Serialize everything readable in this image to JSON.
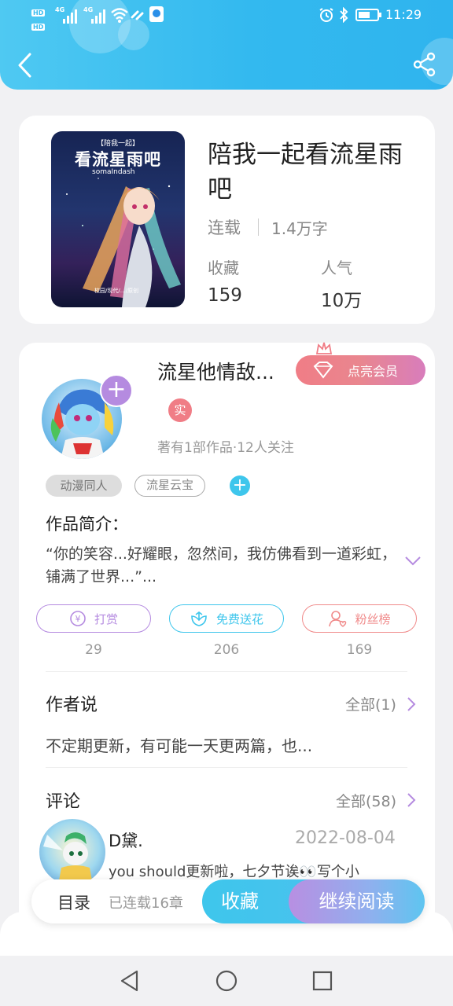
{
  "status_bar": {
    "net1": "4G",
    "net2": "4G",
    "hd1": "HD",
    "hd2": "HD",
    "time": "11:29"
  },
  "book": {
    "title": "陪我一起看流星雨吧",
    "status": "连载",
    "word_count": "1.4万字",
    "collect_label": "收藏",
    "collect_value": "159",
    "popularity_label": "人气",
    "popularity_value": "10万",
    "cover": {
      "top_text": "【陪我一起】",
      "main_text": "看流星雨吧",
      "author_text": "somaIndash",
      "bottom_text": "校园/现代/…/原创"
    }
  },
  "author": {
    "name": "流星他情敌...",
    "verified_badge": "实",
    "stats": "著有1部作品·12人关注",
    "member_button": "点亮会员"
  },
  "tags": [
    "动漫同人",
    "流星云宝"
  ],
  "intro": {
    "heading": "作品简介：",
    "text": "“你的笑容...好耀眼，忽然间，我仿佛看到一道彩虹，铺满了世界...”..."
  },
  "actions": [
    {
      "label": "打赏",
      "count": "29",
      "color": "#b58be0"
    },
    {
      "label": "免费送花",
      "count": "206",
      "color": "#3ec6ec"
    },
    {
      "label": "粉丝榜",
      "count": "169",
      "color": "#f08a8a"
    }
  ],
  "author_says": {
    "heading": "作者说",
    "all_link": "全部(1)",
    "text": "不定期更新，有可能一天更两篇，也..."
  },
  "comments": {
    "heading": "评论",
    "all_link": "全部(58)",
    "first": {
      "user": "D黛.",
      "date": "2022-08-04",
      "text": "you should更新啦，七夕节诶👀写个小"
    }
  },
  "bottom_bar": {
    "toc": "目录",
    "chapters": "已连载16章",
    "collect_button": "收藏",
    "read_button": "继续阅读"
  },
  "colors": {
    "header": "#33b9ef",
    "accent_purple": "#b58be0",
    "accent_cyan": "#3ec6ec",
    "accent_red": "#f07d86"
  }
}
